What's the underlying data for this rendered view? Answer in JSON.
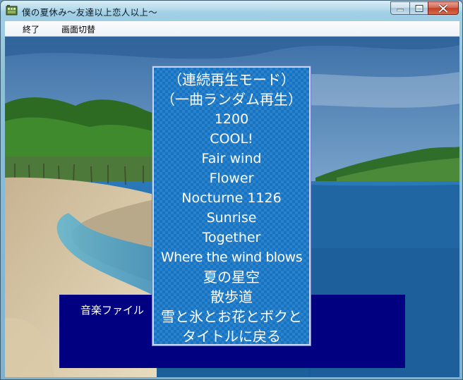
{
  "window": {
    "title": "僕の夏休み〜友達以上恋人以上〜",
    "controls": {
      "minimize": "minimize-icon",
      "maximize": "maximize-icon",
      "close": "close-icon"
    }
  },
  "menubar": {
    "items": [
      "終了",
      "画面切替"
    ]
  },
  "music_menu": {
    "items": [
      "（連続再生モード）",
      "（一曲ランダム再生）",
      "1200",
      "COOL!",
      "Fair wind",
      "Flower",
      "Nocturne 1126",
      "Sunrise",
      "Together",
      "Where the wind blows",
      "夏の星空",
      "散歩道",
      "雪と氷とお花とボクと",
      "タイトルに戻る"
    ]
  },
  "message_box": {
    "text": "音楽ファイル"
  },
  "colors": {
    "menu_background": "#1674c4",
    "menu_border": "#c9d3f2",
    "message_background": "#000080",
    "text": "#ffffff"
  }
}
